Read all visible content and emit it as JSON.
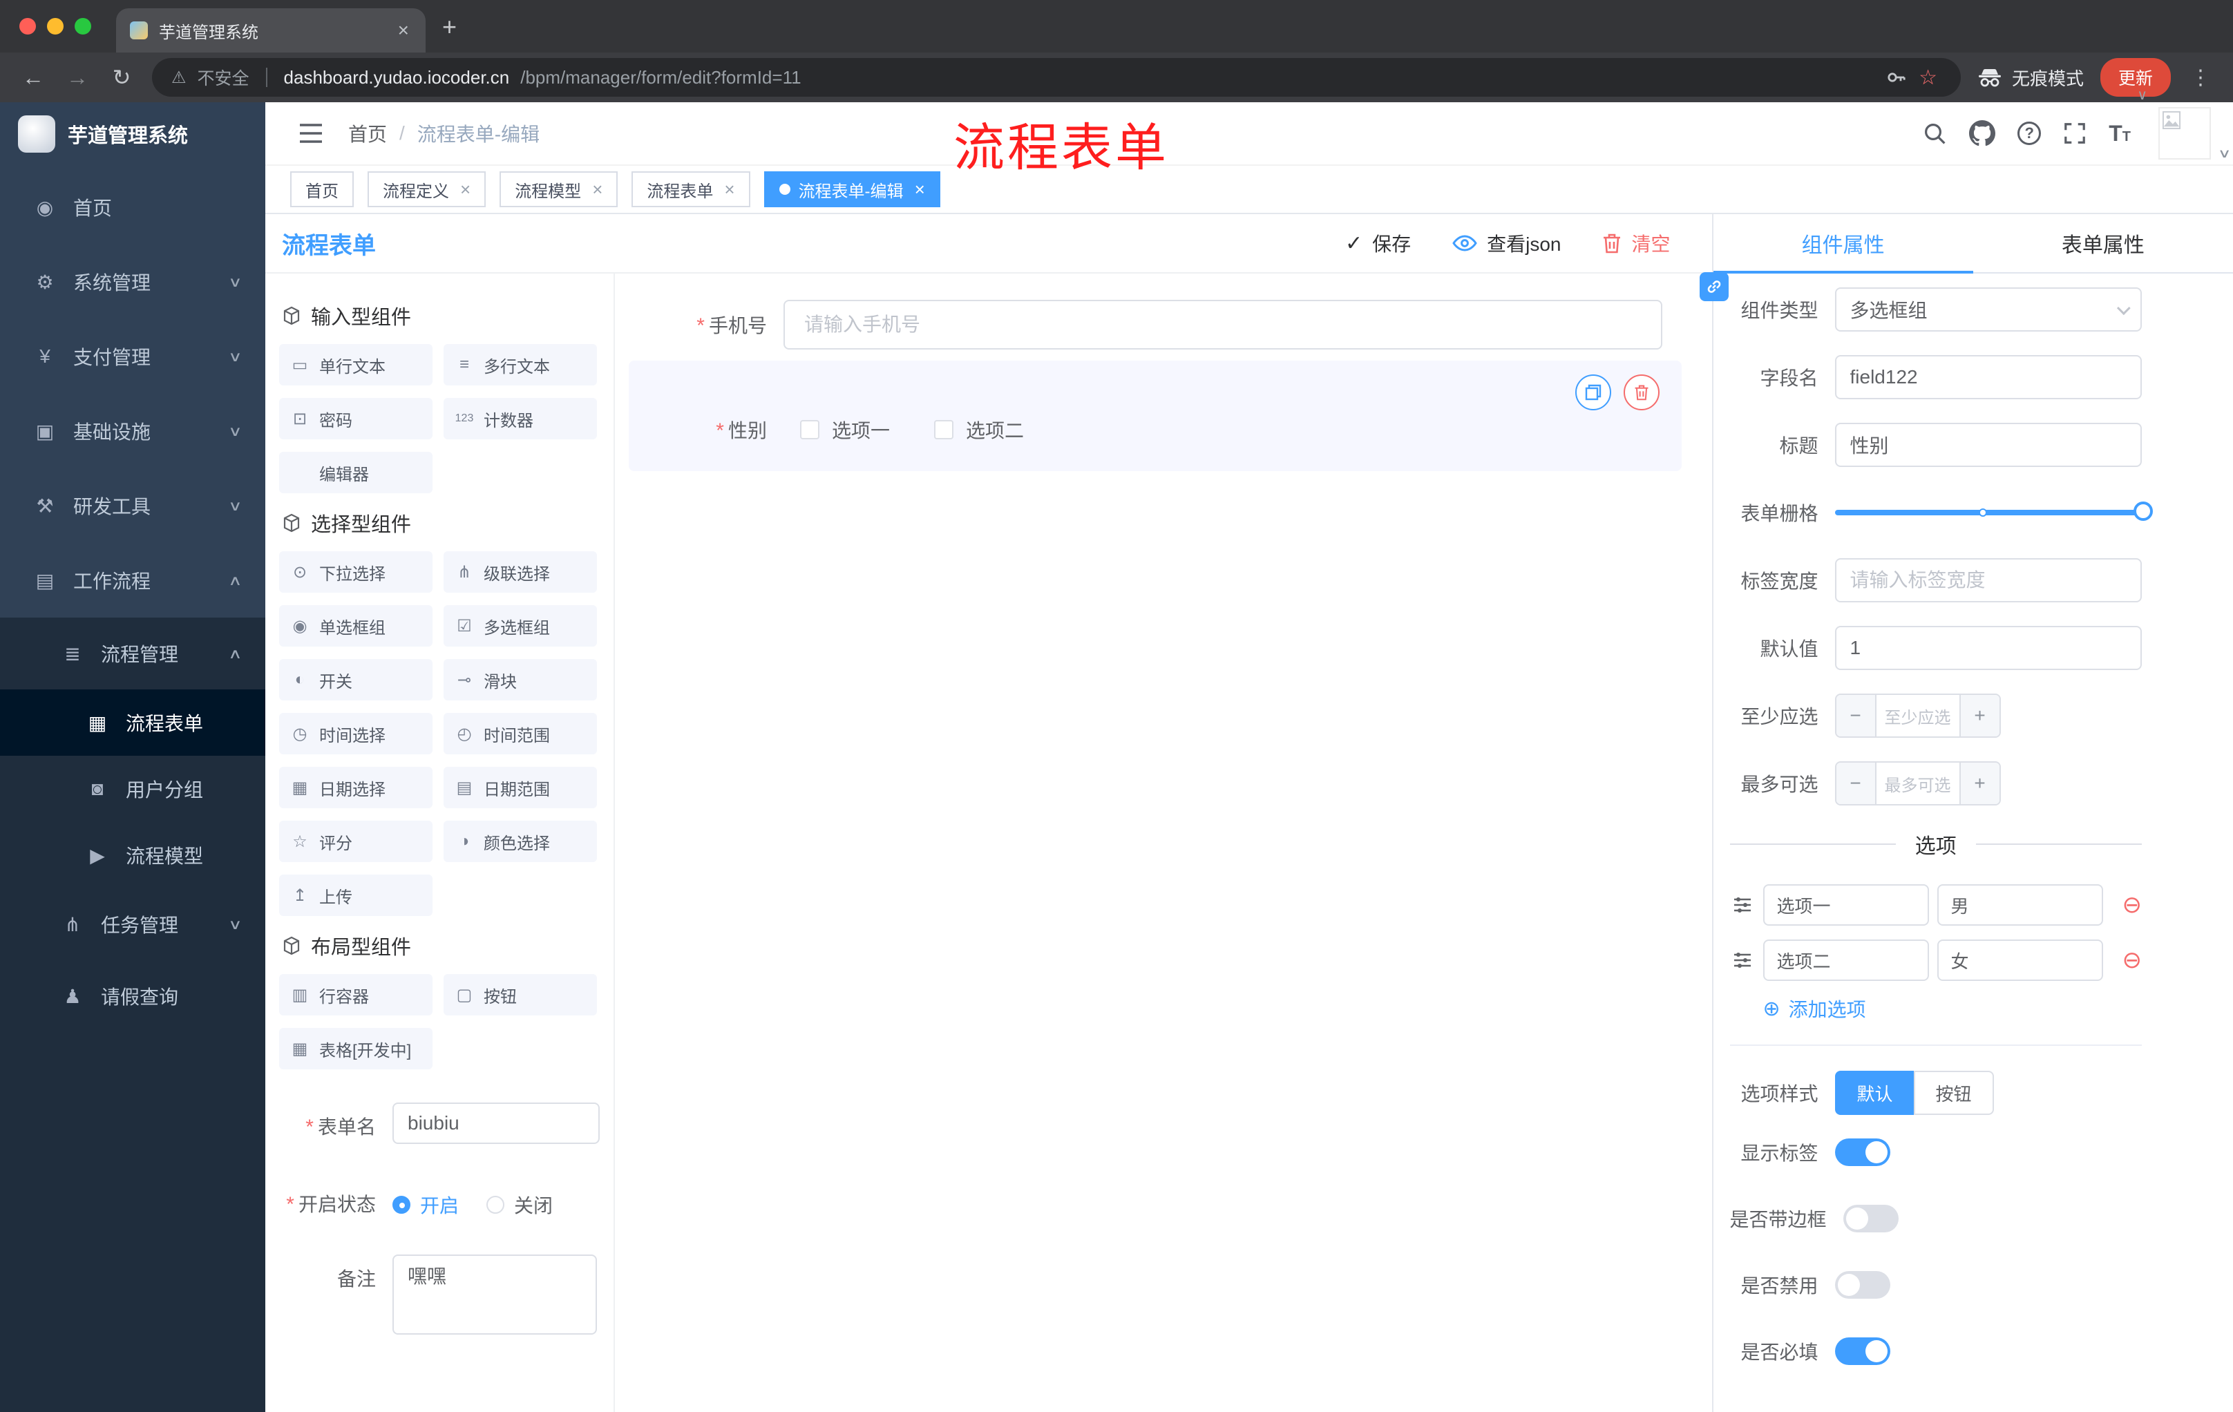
{
  "colors": {
    "accent": "#409eff",
    "danger": "#f56c6c",
    "sidebar_bg": "#304156",
    "sidebar_submenu_bg": "#1f2d3d",
    "active_tag_bg": "#409eff",
    "annotation_red": "#fe1e1e",
    "update_button_bg": "#de4a3a"
  },
  "browser": {
    "tab_title": "芋道管理系统",
    "security_label": "不安全",
    "url_host": "dashboard.yudao.iocoder.cn",
    "url_path": "/bpm/manager/form/edit?formId=11",
    "incognito_label": "无痕模式",
    "update_label": "更新"
  },
  "sidebar": {
    "logo_title": "芋道管理系统",
    "items": [
      {
        "label": "首页",
        "icon": "dashboard-icon"
      },
      {
        "label": "系统管理",
        "icon": "gear-icon"
      },
      {
        "label": "支付管理",
        "icon": "payment-icon"
      },
      {
        "label": "基础设施",
        "icon": "infrastructure-icon"
      },
      {
        "label": "研发工具",
        "icon": "dev-tools-icon"
      },
      {
        "label": "工作流程",
        "icon": "workflow-icon",
        "expanded": true
      },
      {
        "label": "流程管理",
        "icon": "process-manage-icon",
        "expanded": true
      },
      {
        "label": "流程表单",
        "icon": "form-icon",
        "active": true
      },
      {
        "label": "用户分组",
        "icon": "user-group-icon"
      },
      {
        "label": "流程模型",
        "icon": "model-icon"
      },
      {
        "label": "任务管理",
        "icon": "task-icon"
      },
      {
        "label": "请假查询",
        "icon": "leave-query-icon"
      }
    ]
  },
  "header": {
    "breadcrumb": [
      "首页",
      "流程表单-编辑"
    ],
    "annotation": "流程表单"
  },
  "tags": [
    {
      "label": "首页",
      "closable": false,
      "active": false
    },
    {
      "label": "流程定义",
      "closable": true,
      "active": false
    },
    {
      "label": "流程模型",
      "closable": true,
      "active": false
    },
    {
      "label": "流程表单",
      "closable": true,
      "active": false
    },
    {
      "label": "流程表单-编辑",
      "closable": true,
      "active": true
    }
  ],
  "toolbar": {
    "title": "流程表单",
    "save_label": "保存",
    "view_json_label": "查看json",
    "clear_label": "清空"
  },
  "palette": {
    "sections": [
      {
        "title": "输入型组件",
        "items": [
          {
            "label": "单行文本",
            "icon": "single-line-text-icon"
          },
          {
            "label": "多行文本",
            "icon": "multi-line-text-icon"
          },
          {
            "label": "密码",
            "icon": "password-icon"
          },
          {
            "label": "计数器",
            "icon": "counter-icon"
          },
          {
            "label": "编辑器",
            "icon": "editor-icon"
          }
        ]
      },
      {
        "title": "选择型组件",
        "items": [
          {
            "label": "下拉选择",
            "icon": "select-icon"
          },
          {
            "label": "级联选择",
            "icon": "cascader-icon"
          },
          {
            "label": "单选框组",
            "icon": "radio-group-icon"
          },
          {
            "label": "多选框组",
            "icon": "checkbox-group-icon"
          },
          {
            "label": "开关",
            "icon": "switch-icon"
          },
          {
            "label": "滑块",
            "icon": "slider-icon"
          },
          {
            "label": "时间选择",
            "icon": "time-picker-icon"
          },
          {
            "label": "时间范围",
            "icon": "time-range-icon"
          },
          {
            "label": "日期选择",
            "icon": "date-picker-icon"
          },
          {
            "label": "日期范围",
            "icon": "date-range-icon"
          },
          {
            "label": "评分",
            "icon": "rate-icon"
          },
          {
            "label": "颜色选择",
            "icon": "color-picker-icon"
          },
          {
            "label": "上传",
            "icon": "upload-icon"
          }
        ]
      },
      {
        "title": "布局型组件",
        "items": [
          {
            "label": "行容器",
            "icon": "row-container-icon"
          },
          {
            "label": "按钮",
            "icon": "button-icon"
          },
          {
            "label": "表格[开发中]",
            "icon": "table-icon"
          }
        ]
      }
    ],
    "form": {
      "name_label": "表单名",
      "name_value": "biubiu",
      "status_label": "开启状态",
      "status_options": [
        {
          "label": "开启",
          "selected": true
        },
        {
          "label": "关闭",
          "selected": false
        }
      ],
      "remark_label": "备注",
      "remark_value": "嘿嘿"
    }
  },
  "canvas": {
    "phone_label": "手机号",
    "phone_placeholder": "请输入手机号",
    "gender_label": "性别",
    "gender_options": [
      "选项一",
      "选项二"
    ]
  },
  "panel": {
    "tabs": [
      {
        "label": "组件属性",
        "active": true
      },
      {
        "label": "表单属性",
        "active": false
      }
    ],
    "component_type_label": "组件类型",
    "component_type_value": "多选框组",
    "field_name_label": "字段名",
    "field_name_value": "field122",
    "title_label": "标题",
    "title_value": "性别",
    "grid_label": "表单栅格",
    "label_width_label": "标签宽度",
    "label_width_placeholder": "请输入标签宽度",
    "default_label": "默认值",
    "default_value": "1",
    "min_label": "至少应选",
    "min_placeholder": "至少应选",
    "max_label": "最多可选",
    "max_placeholder": "最多可选",
    "options_title": "选项",
    "options": [
      {
        "label": "选项一",
        "value": "男"
      },
      {
        "label": "选项二",
        "value": "女"
      }
    ],
    "add_option_label": "添加选项",
    "style_label": "选项样式",
    "style_options": [
      {
        "label": "默认",
        "active": true
      },
      {
        "label": "按钮",
        "active": false
      }
    ],
    "switches": [
      {
        "label": "显示标签",
        "on": true
      },
      {
        "label": "是否带边框",
        "on": false
      },
      {
        "label": "是否禁用",
        "on": false
      },
      {
        "label": "是否必填",
        "on": true
      }
    ]
  }
}
